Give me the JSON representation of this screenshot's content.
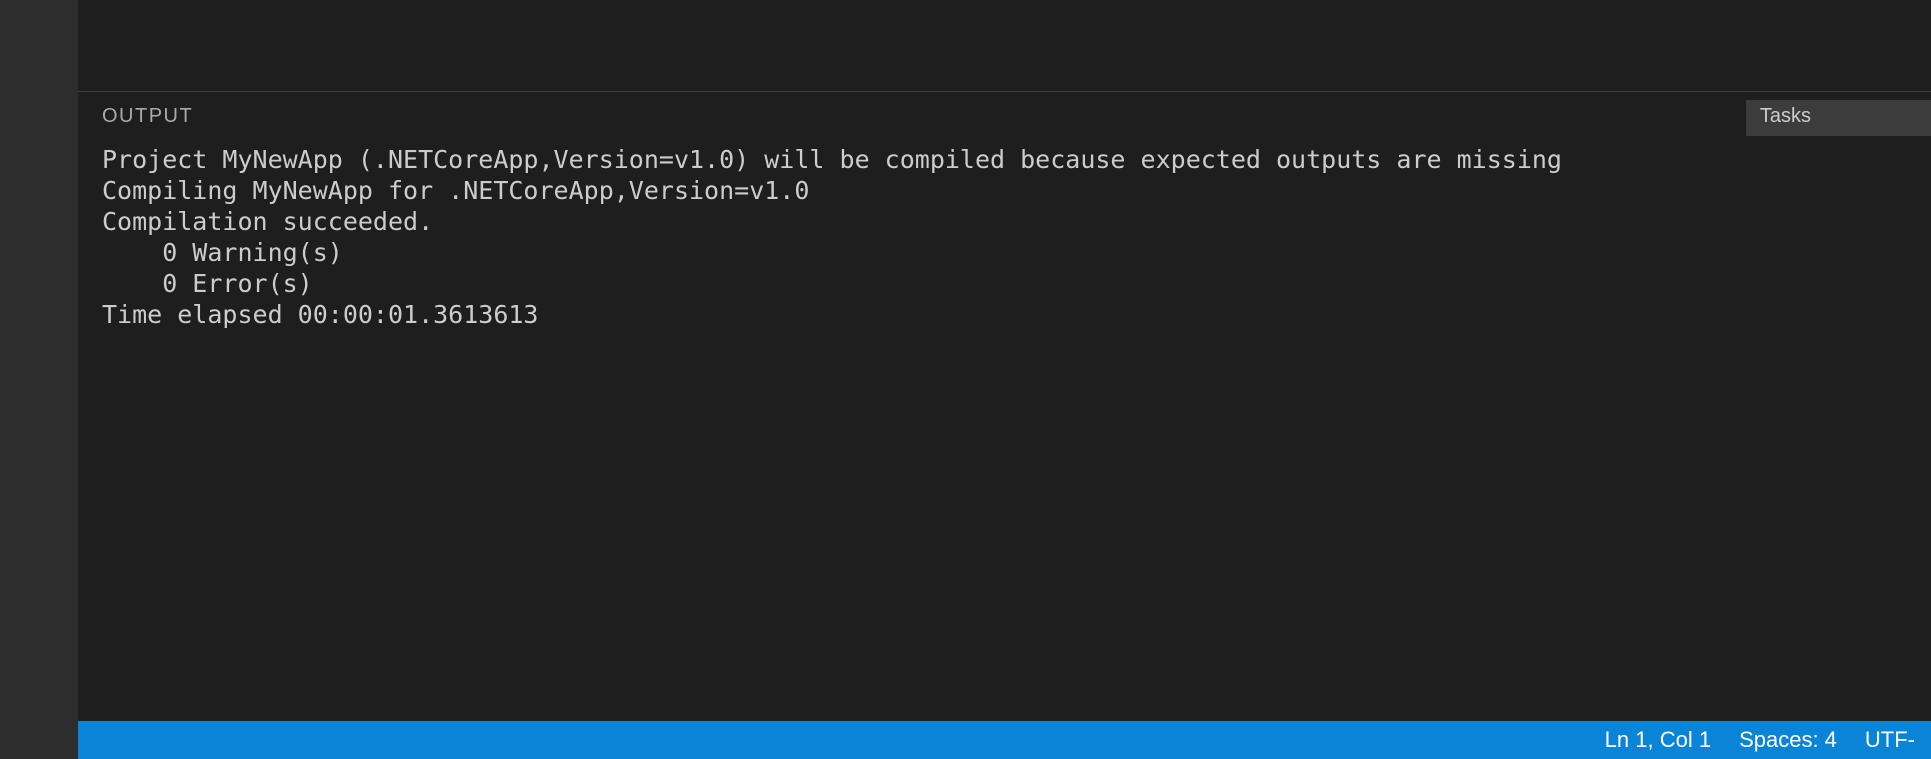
{
  "panel": {
    "tab_label": "OUTPUT",
    "channel_selected": "Tasks",
    "lines": [
      "Project MyNewApp (.NETCoreApp,Version=v1.0) will be compiled because expected outputs are missing",
      "Compiling MyNewApp for .NETCoreApp,Version=v1.0",
      "Compilation succeeded.",
      "    0 Warning(s)",
      "    0 Error(s)",
      "Time elapsed 00:00:01.3613613"
    ]
  },
  "status": {
    "cursor": "Ln 1, Col 1",
    "spaces": "Spaces: 4",
    "encoding": "UTF-"
  }
}
